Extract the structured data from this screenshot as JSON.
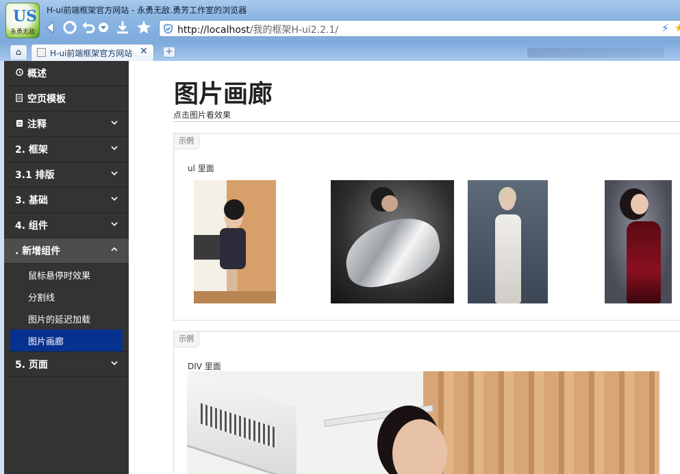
{
  "browser": {
    "logo_text": "永勇无敌",
    "window_title": "H-ui前端框架官方网站 - 永勇无敌.勇芳工作室的浏览器",
    "url_host": "http://localhost",
    "url_path": "/我的框架H-ui2.2.1/",
    "tab_title": "H-ui前端框架官方网站",
    "icons": {
      "back": "back-arrow-icon",
      "refresh": "refresh-icon",
      "undo": "undo-icon",
      "menu": "dropdown-icon",
      "download": "download-icon",
      "favorite": "star-icon"
    }
  },
  "sidebar": {
    "items": [
      {
        "label": "概述",
        "icon": "overview-icon",
        "expandable": false
      },
      {
        "label": "空页模板",
        "icon": "page-icon",
        "expandable": false
      },
      {
        "label": "注释",
        "icon": "note-icon",
        "expandable": true
      },
      {
        "label": "2. 框架",
        "expandable": true
      },
      {
        "label": "3.1 排版",
        "expandable": true
      },
      {
        "label": "3. 基础",
        "expandable": true
      },
      {
        "label": "4. 组件",
        "expandable": true
      },
      {
        "label": ". 新增组件",
        "expandable": true,
        "open": true,
        "children": [
          {
            "label": "鼠标悬停时效果"
          },
          {
            "label": "分割线"
          },
          {
            "label": "图片的延迟加载"
          },
          {
            "label": "图片画廊",
            "active": true
          }
        ]
      },
      {
        "label": "5. 页面",
        "expandable": true
      }
    ],
    "colors": {
      "background": "#333333",
      "open": "#4d4d4d",
      "active": "#06318e"
    }
  },
  "main": {
    "title": "图片画廊",
    "subtitle": "点击图片看效果",
    "panels": [
      {
        "tag": "示例",
        "label": "ul 里面",
        "images": [
          "photo-1",
          "photo-2",
          "photo-3",
          "photo-4"
        ]
      },
      {
        "tag": "示例",
        "label": "DIV 里面",
        "images": [
          "photo-large"
        ]
      }
    ]
  }
}
